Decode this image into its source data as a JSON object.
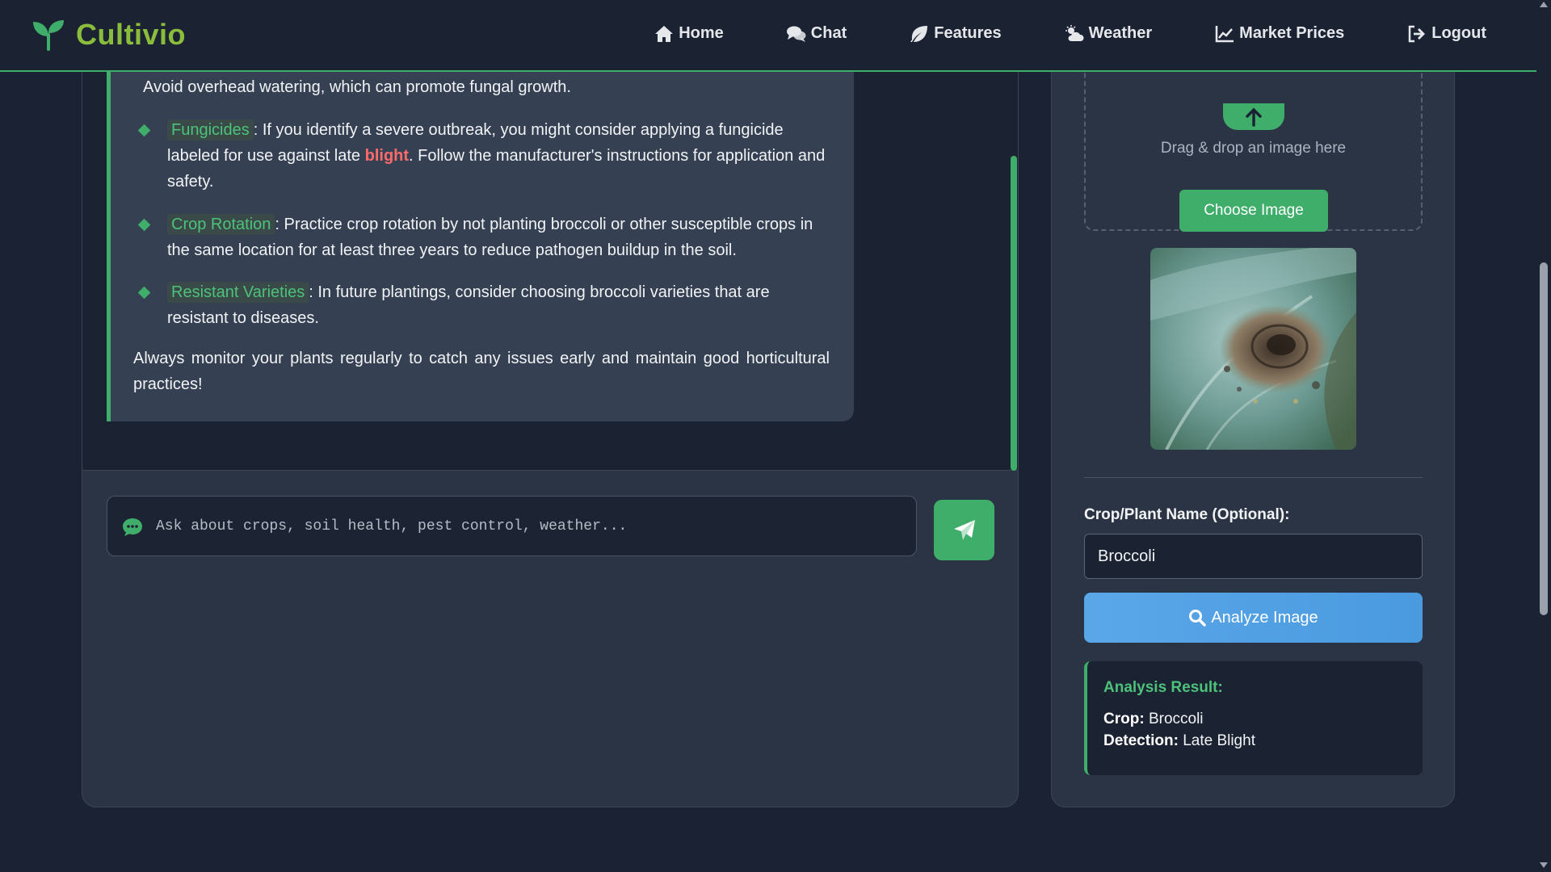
{
  "brand": {
    "name": "Cultivio",
    "icon": "seedling-icon"
  },
  "nav": {
    "items": [
      {
        "label": "Home",
        "icon": "home-icon"
      },
      {
        "label": "Chat",
        "icon": "comments-icon"
      },
      {
        "label": "Features",
        "icon": "leaf-icon"
      },
      {
        "label": "Weather",
        "icon": "cloud-sun-icon"
      },
      {
        "label": "Market Prices",
        "icon": "chart-line-icon"
      },
      {
        "label": "Logout",
        "icon": "logout-icon"
      }
    ]
  },
  "chat": {
    "message": {
      "intro_line": "Avoid overhead watering, which can promote fungal growth.",
      "bullets": [
        {
          "tag": "Fungicides",
          "text_before": ": If you identify a severe outbreak, you might consider applying a fungicide labeled for use against late ",
          "highlight": "blight",
          "text_after": ". Follow the manufacturer's instructions for application and safety."
        },
        {
          "tag": "Crop Rotation",
          "text": ": Practice crop rotation by not planting broccoli or other susceptible crops in the same location for at least three years to reduce pathogen buildup in the soil."
        },
        {
          "tag": "Resistant Varieties",
          "text": ": In future plantings, consider choosing broccoli varieties that are resistant to diseases."
        }
      ],
      "closing": "Always monitor your plants regularly to catch any issues early and maintain good horticultural practices!"
    },
    "input": {
      "placeholder": "Ask about crops, soil health, pest control, weather...",
      "value": ""
    }
  },
  "analysis": {
    "drop_text": "Drag & drop an image here",
    "choose_label": "Choose Image",
    "crop_label": "Crop/Plant Name (Optional):",
    "crop_value": "Broccoli",
    "analyze_label": "Analyze Image",
    "result": {
      "title": "Analysis Result:",
      "crop_key": "Crop:",
      "crop_val": "Broccoli",
      "detection_key": "Detection:",
      "detection_val": "Late Blight"
    }
  },
  "colors": {
    "accent_green": "#3fae6a",
    "brand_green": "#8bbd3c",
    "highlight_red": "#ff6b6b",
    "analyze_blue": "#4a9ae0"
  }
}
